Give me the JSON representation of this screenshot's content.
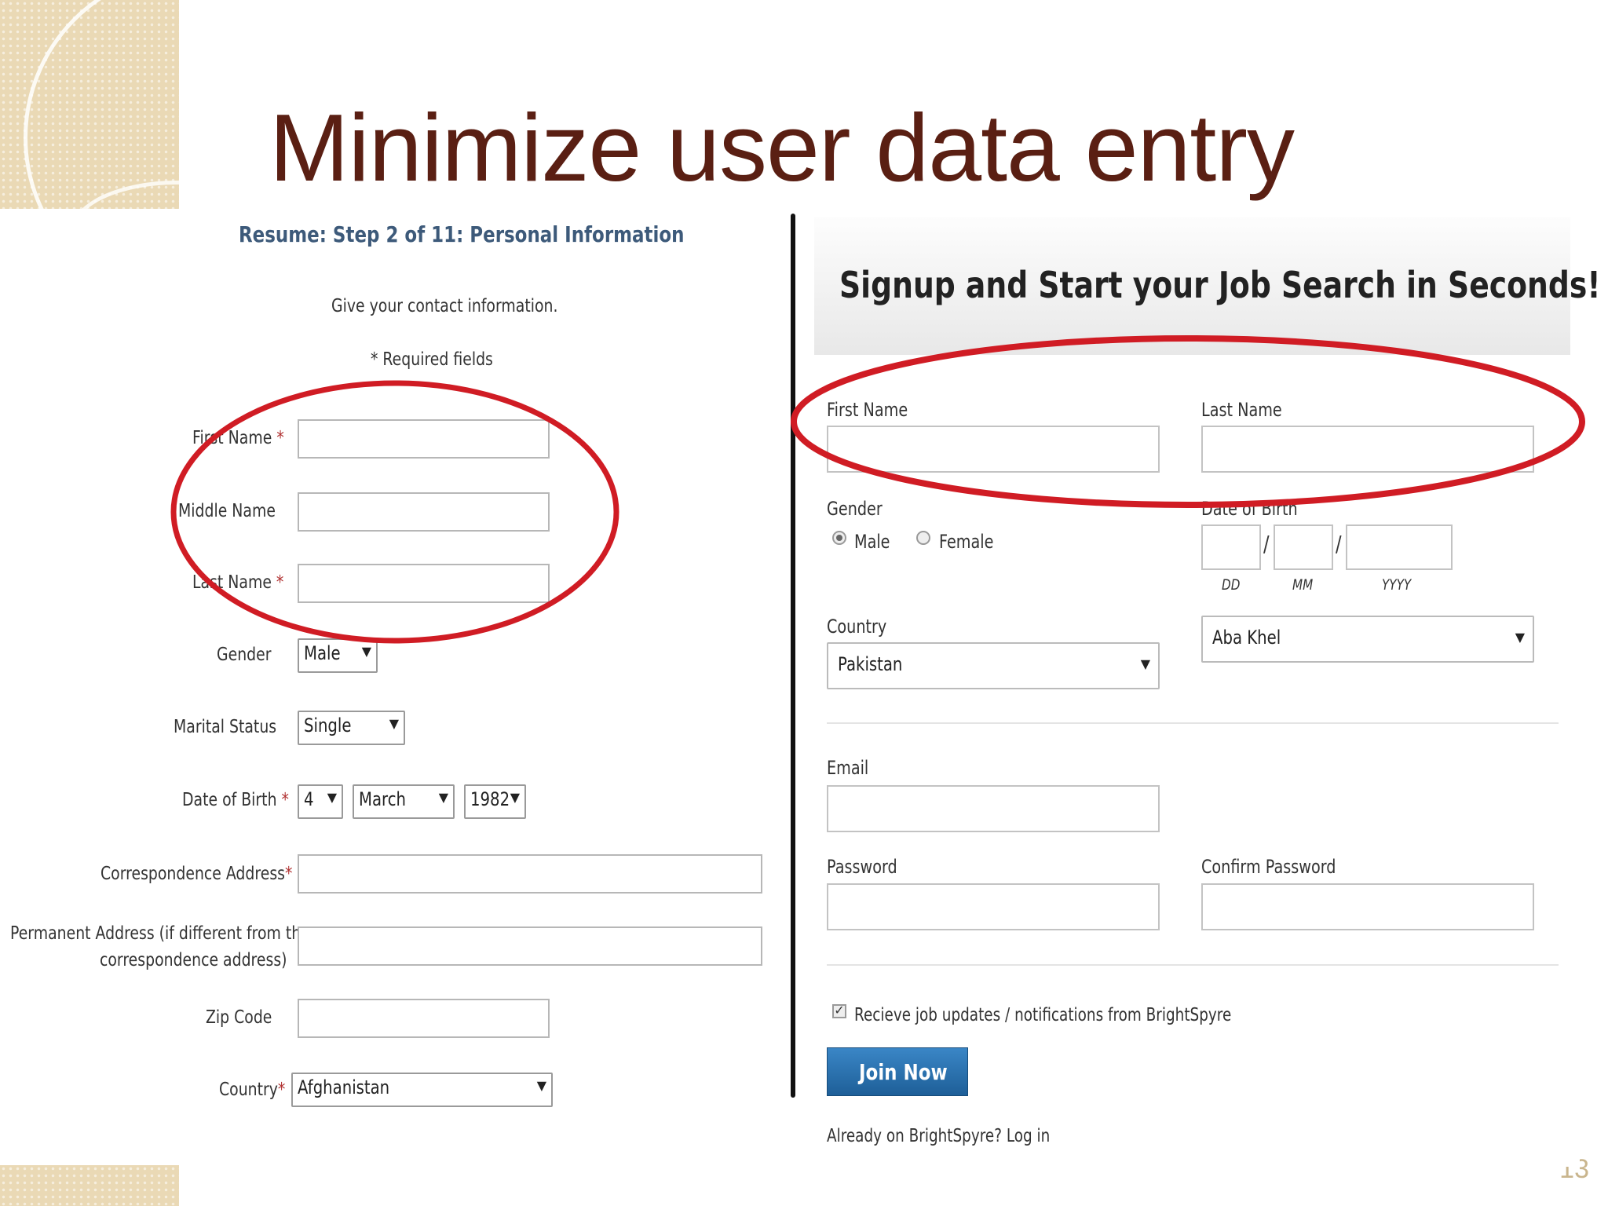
{
  "slide": {
    "title": "Minimize user data entry",
    "page_number": "13"
  },
  "left_form": {
    "heading": "Resume: Step 2 of 11: Personal Information",
    "instruction": "Give your contact information.",
    "required_note": "* Required fields",
    "fields": {
      "first_name_label": "First Name",
      "middle_name_label": "Middle Name",
      "last_name_label": "Last Name",
      "gender_label": "Gender",
      "gender_value": "Male",
      "marital_label": "Marital Status",
      "marital_value": "Single",
      "dob_label": "Date of Birth",
      "dob_day": "4",
      "dob_month": "March",
      "dob_year": "1982",
      "corr_address_label": "Correspondence Address",
      "perm_address_label_1": "Permanent Address (if different from the",
      "perm_address_label_2": "correspondence address)",
      "zip_label": "Zip Code",
      "country_label": "Country",
      "country_value": "Afghanistan",
      "asterisk": "*"
    }
  },
  "right_form": {
    "heading": "Signup and Start your Job Search in Seconds!",
    "first_name_label": "First Name",
    "last_name_label": "Last Name",
    "gender_label": "Gender",
    "gender_male": "Male",
    "gender_female": "Female",
    "dob_label": "Date of Birth",
    "dob_dd": "DD",
    "dob_mm": "MM",
    "dob_yyyy": "YYYY",
    "dob_sep": "/",
    "country_label": "Country",
    "country_value": "Pakistan",
    "city_value": "Aba Khel",
    "email_label": "Email",
    "password_label": "Password",
    "confirm_password_label": "Confirm Password",
    "updates_checkbox_label": "Recieve job updates / notifications from BrightSpyre",
    "join_button": "Join Now",
    "login_text": "Already on BrightSpyre? Log in"
  },
  "colors": {
    "title": "#5a1f13",
    "highlight_oval": "#d01c24",
    "join_button": "#2a70ae",
    "decoration": "#ead9b5"
  }
}
